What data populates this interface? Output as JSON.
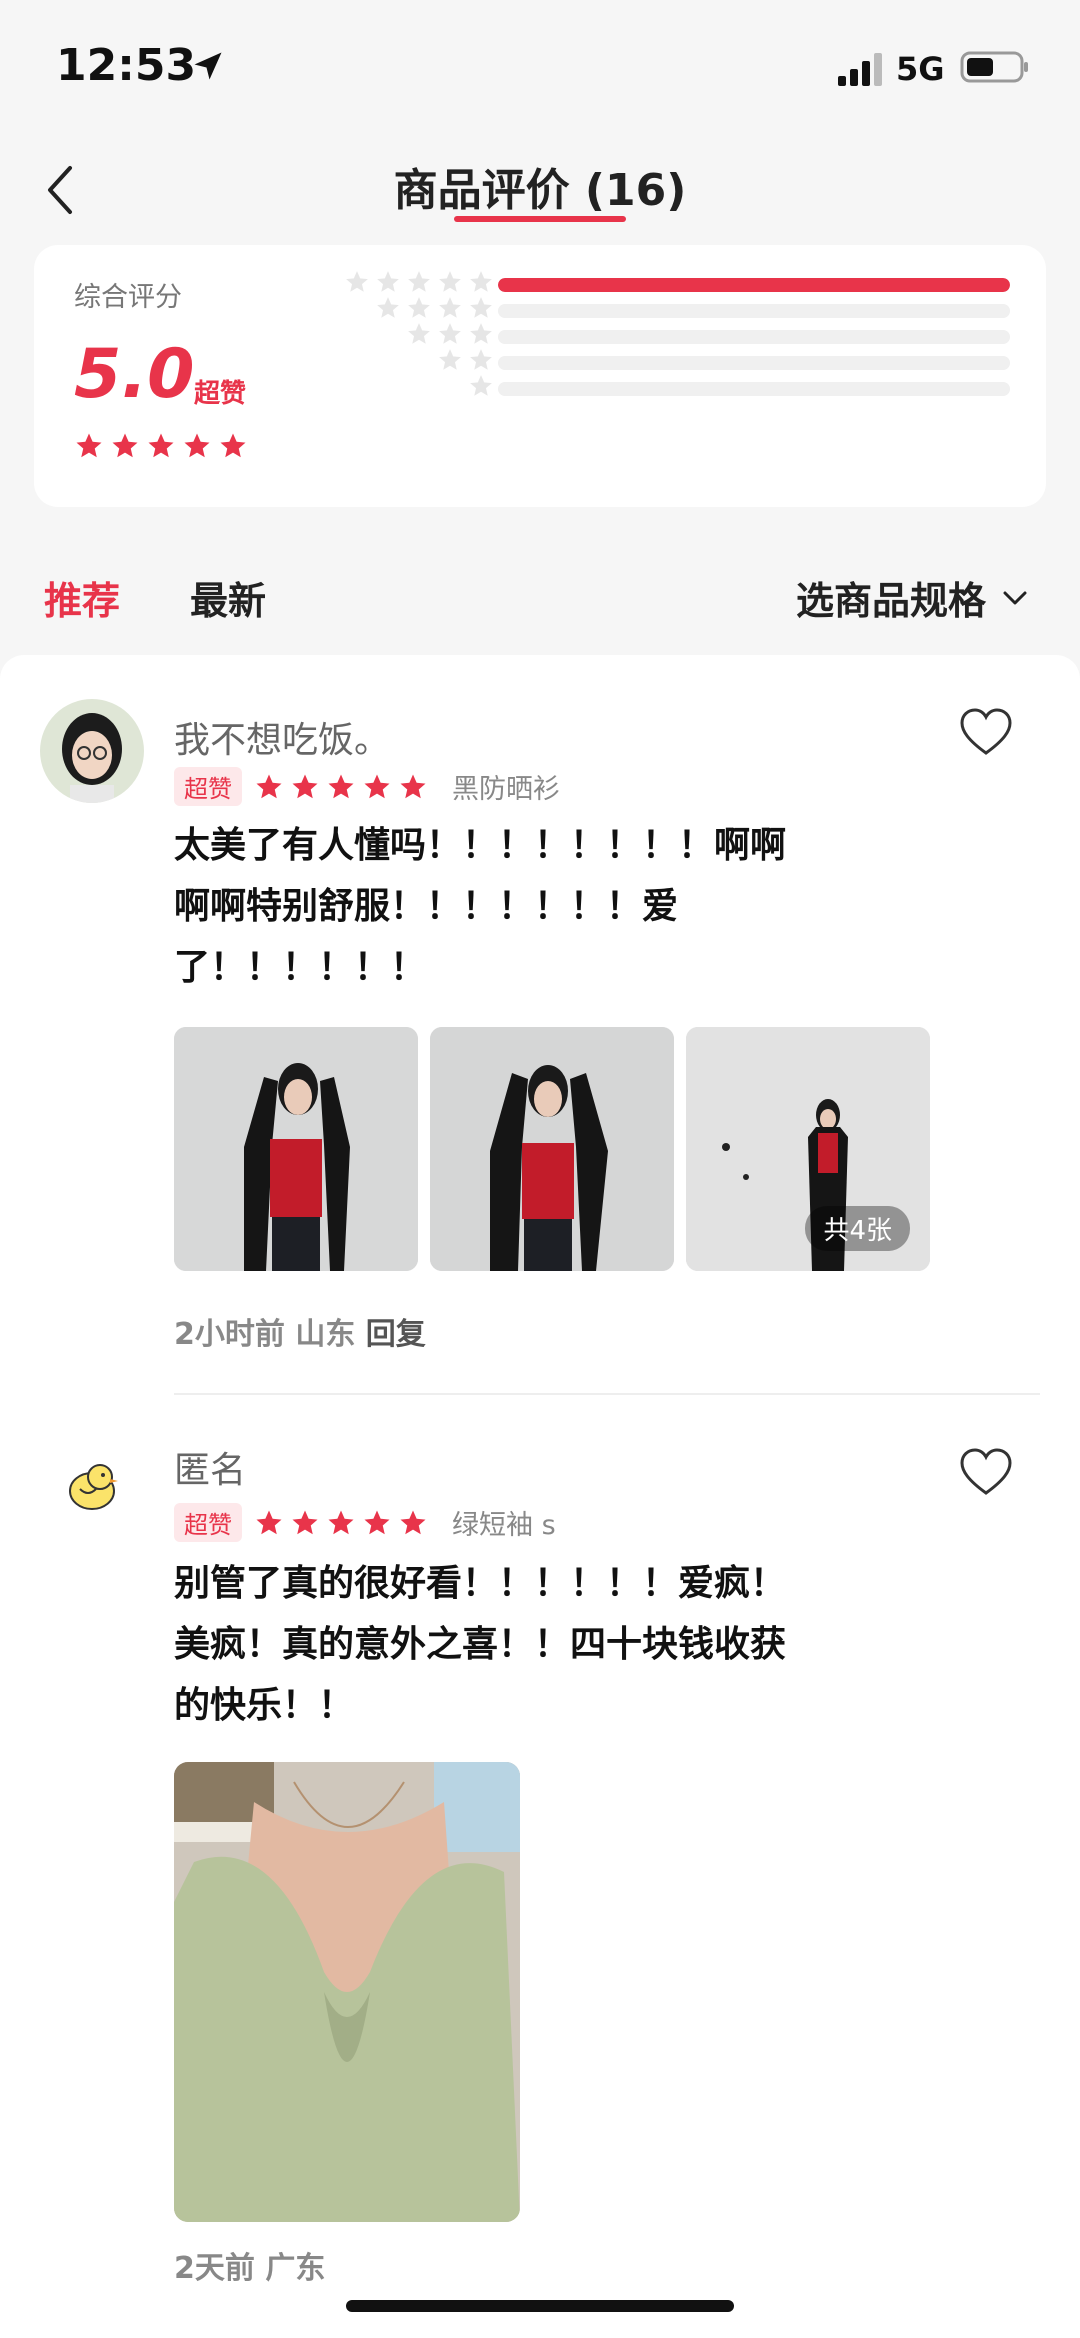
{
  "status_bar": {
    "time": "12:53",
    "network": "5G"
  },
  "nav": {
    "title": "商品评价 (16)"
  },
  "rating_summary": {
    "label": "综合评分",
    "score": "5.0",
    "score_word": "超赞",
    "stars": 5,
    "distribution": [
      {
        "stars": 5,
        "fraction": 1.0
      },
      {
        "stars": 4,
        "fraction": 0
      },
      {
        "stars": 3,
        "fraction": 0
      },
      {
        "stars": 2,
        "fraction": 0
      },
      {
        "stars": 1,
        "fraction": 0
      }
    ]
  },
  "filters": {
    "tabs": [
      {
        "label": "推荐",
        "active": true
      },
      {
        "label": "最新",
        "active": false
      }
    ],
    "spec_select": "选商品规格"
  },
  "reviews": [
    {
      "username": "我不想吃饭。",
      "badge": "超赞",
      "stars": 5,
      "spec": "黑防晒衫",
      "lines": [
        "太美了有人懂吗！！！！！！！！啊啊",
        "啊啊特别舒服！！！！！！！爱",
        "了！！！！！！"
      ],
      "photo_count": "共4张",
      "time": "2小时前",
      "region": "山东",
      "reply": "回复"
    },
    {
      "username": "匿名",
      "badge": "超赞",
      "stars": 5,
      "spec": "绿短袖 s",
      "lines": [
        "别管了真的很好看！！！！！！爱疯！",
        "美疯！真的意外之喜！！四十块钱收获",
        "的快乐！！"
      ],
      "time": "2天前",
      "region": "广东"
    }
  ],
  "colors": {
    "accent": "#e8344a",
    "muted_star": "#e6e6e6"
  }
}
